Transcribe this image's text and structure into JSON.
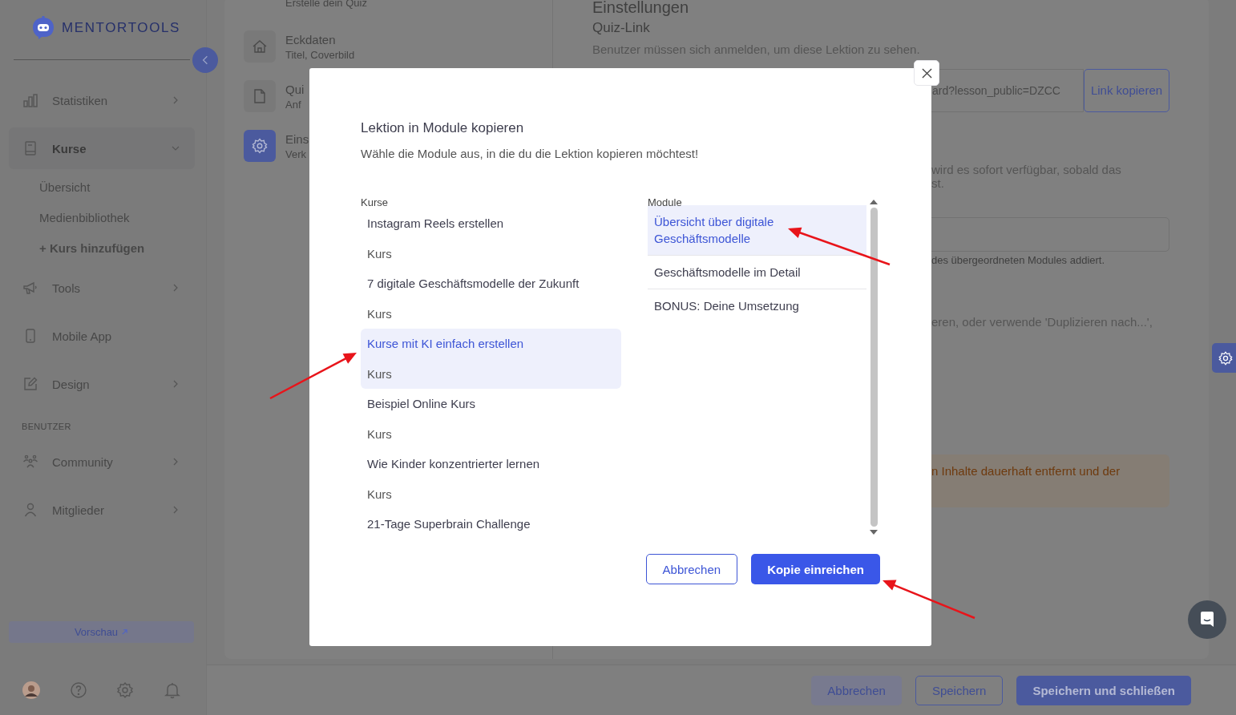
{
  "sidebar": {
    "logo": "MENTORTOOLS",
    "sections": [
      {
        "items": [
          {
            "label": "Statistiken",
            "kind": "group",
            "expanded": false,
            "selected": false
          },
          {
            "label": "Kurse",
            "kind": "group",
            "expanded": true,
            "selected": true,
            "children": [
              {
                "label": "Übersicht",
                "kind": "link"
              },
              {
                "label": "Medienbibliothek",
                "kind": "link"
              },
              {
                "label": "+ Kurs hinzufügen",
                "kind": "add"
              }
            ]
          },
          {
            "label": "Tools",
            "kind": "group",
            "expanded": false,
            "selected": false
          },
          {
            "label": "Mobile App",
            "kind": "link",
            "selected": false
          },
          {
            "label": "Design",
            "kind": "group",
            "expanded": false,
            "selected": false
          }
        ]
      },
      {
        "title": "BENUTZER",
        "items": [
          {
            "label": "Community",
            "kind": "group",
            "expanded": false,
            "selected": false
          },
          {
            "label": "Mitglieder",
            "kind": "group",
            "expanded": false,
            "selected": false
          }
        ]
      }
    ],
    "preview_button": "Vorschau"
  },
  "steps": [
    {
      "subtitle": "Erstelle dein Quiz",
      "kind": "partial"
    },
    {
      "title": "Eckdaten",
      "subtitle": "Titel, Coverbild",
      "kind": "full",
      "selected": false
    },
    {
      "title": "Qui",
      "subtitle": "Anf",
      "kind": "full",
      "selected": false
    },
    {
      "title": "Eins",
      "subtitle": "Verk",
      "kind": "full",
      "selected": true
    }
  ],
  "settings": {
    "heading": "Einstellungen",
    "quiz_link_label": "Quiz-Link",
    "hint": "Benutzer müssen sich anmelden, um diese Lektion zu sehen.",
    "link_field": {
      "value": "ard?lesson_public=DZCC"
    },
    "copy_button": "Link kopieren",
    "text_1": "wird es sofort verfügbar, sobald das",
    "text_2": "st.",
    "helper": "des übergeordneten Modules addiert.",
    "text_3": "eren, oder verwende 'Duplizieren nach...',",
    "warning": "n Inhalte dauerhaft entfernt und der"
  },
  "footer_buttons": [
    {
      "label": "Abbrechen",
      "kind": "ghost"
    },
    {
      "label": "Speichern",
      "kind": "outline"
    },
    {
      "label": "Speichern und schließen",
      "kind": "primary"
    }
  ],
  "modal": {
    "title": "Lektion in Module kopieren",
    "subtitle": "Wähle die Module aus, in die du die Lektion kopieren möchtest!",
    "courses_label": "Kurse",
    "courses": [
      {
        "title": "Instagram Reels erstellen",
        "subtitle": "Kurs",
        "selected": false
      },
      {
        "title": "7 digitale Geschäftsmodelle der Zukunft",
        "subtitle": "Kurs",
        "selected": false
      },
      {
        "title": "Kurse mit KI einfach erstellen",
        "subtitle": "Kurs",
        "selected": true
      },
      {
        "title": "Beispiel Online Kurs",
        "subtitle": "Kurs",
        "selected": false
      },
      {
        "title": "Wie Kinder konzentrierter lernen",
        "subtitle": "Kurs",
        "selected": false
      },
      {
        "title": "21-Tage Superbrain Challenge",
        "selected": false
      }
    ],
    "modules_label": "Module",
    "modules": [
      {
        "title": "Übersicht über digitale Geschäftsmodelle",
        "selected": true
      },
      {
        "title": "Geschäftsmodelle im Detail",
        "selected": false
      },
      {
        "title": "BONUS: Deine Umsetzung",
        "selected": false
      }
    ],
    "cancel_button": "Abbrechen",
    "submit_button": "Kopie einreichen"
  }
}
